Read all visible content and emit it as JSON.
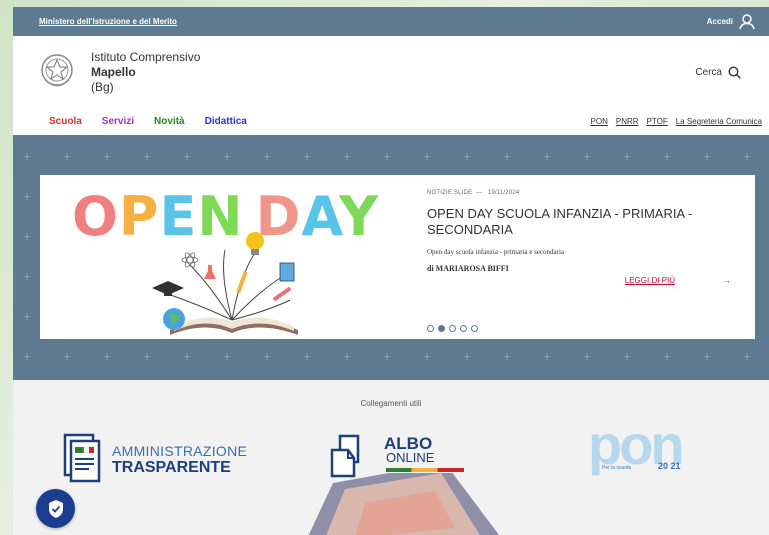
{
  "topbar": {
    "ministry": "Ministero dell'Istruzione e del Merito",
    "login": "Accedi",
    "login_icon": "user-icon"
  },
  "header": {
    "line1": "Istituto Comprensivo",
    "line2": "Mapello",
    "line3": "(Bg)",
    "emblem_icon": "republic-emblem",
    "search_label": "Cerca",
    "search_icon": "search-icon"
  },
  "nav": {
    "main": [
      {
        "label": "Scuola",
        "color": "#d32f2f"
      },
      {
        "label": "Servizi",
        "color": "#a32fbf"
      },
      {
        "label": "Novità",
        "color": "#2e7d32"
      },
      {
        "label": "Didattica",
        "color": "#2b2fd6"
      }
    ],
    "secondary": [
      "PON",
      "PNRR",
      "PTOF",
      "La Segreteria Comunica"
    ]
  },
  "slide": {
    "image_text": "OPEN DAY",
    "meta": "NOTIZIE SLIDE",
    "date": "19/11/2024",
    "title": "OPEN DAY SCUOLA INFANZIA - PRIMARIA - SECONDARIA",
    "subtitle": "Open day scuola infanzia - primaria e secondaria",
    "author": "di MARIAROSA BIFFI",
    "readmore": "LEGGI DI PIÙ",
    "arrow": "→",
    "dots_total": 5,
    "dot_active_index": 1
  },
  "links": {
    "title": "Collegamenti utili",
    "amministrazione_line1": "AMMINISTRAZIONE",
    "amministrazione_line2": "TRASPARENTE",
    "albo_line1": "ALBO",
    "albo_line2": "ONLINE",
    "pon_text": "pon",
    "pon_sub": "Per la scuola",
    "pon_years": "20 21"
  },
  "colors": {
    "topbar": "#5d7a90",
    "accent_red": "#c8102e",
    "shield": "#1a3d8f"
  }
}
